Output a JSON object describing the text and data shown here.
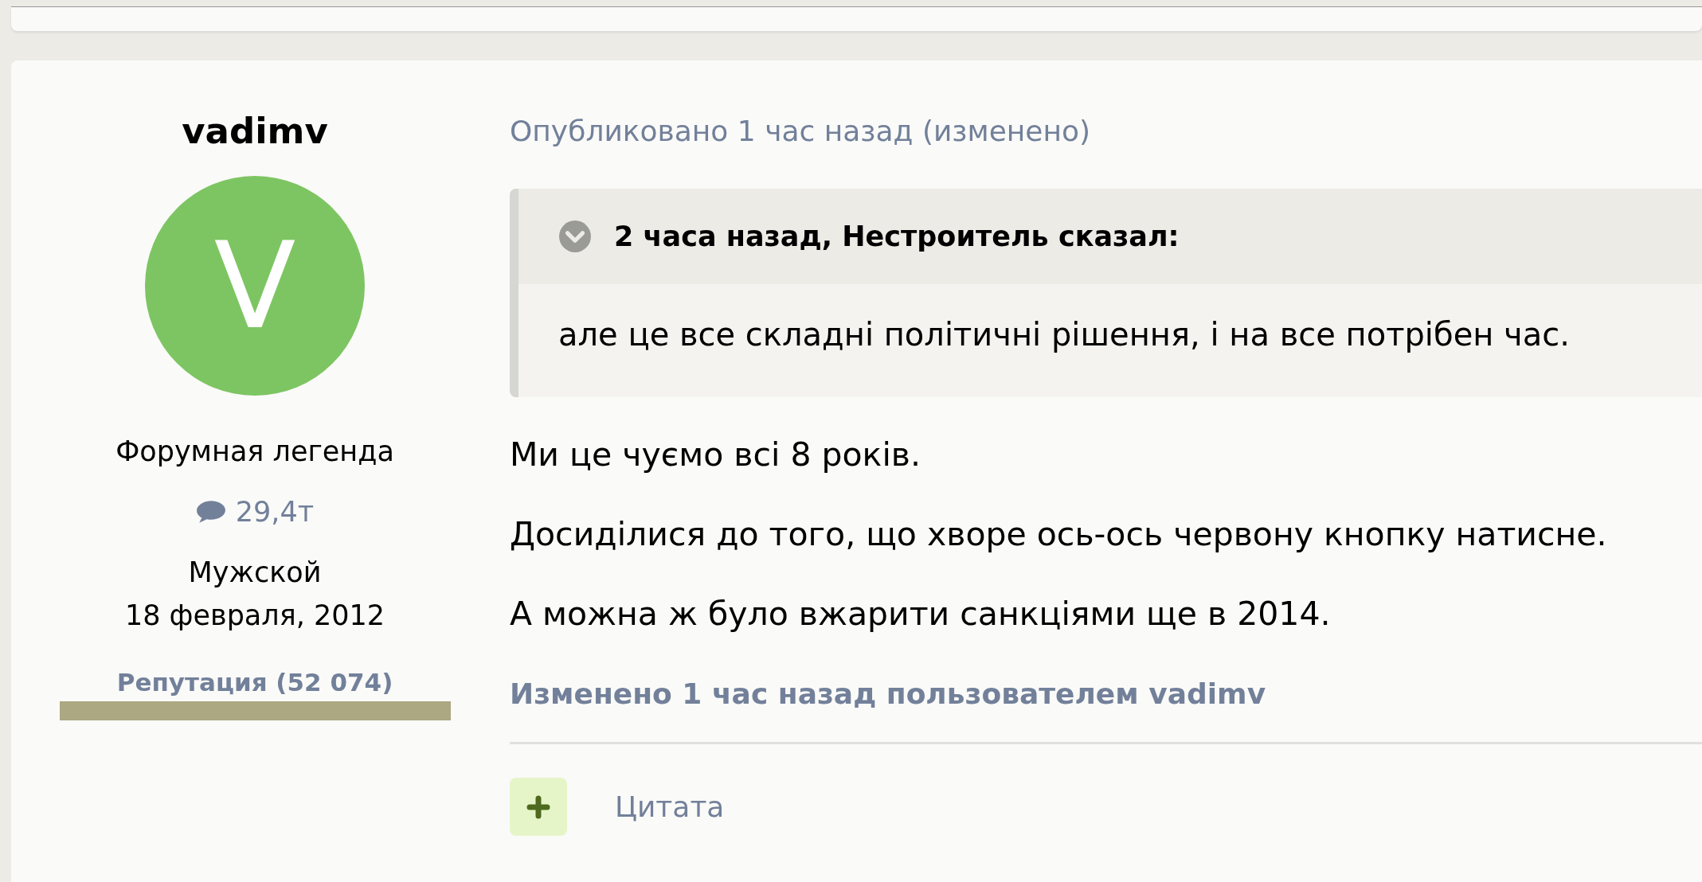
{
  "author": {
    "name": "vadimv",
    "avatar_letter": "V",
    "rank": "Форумная легенда",
    "posts": "29,4т",
    "gender": "Мужской",
    "joined": "18 февраля, 2012",
    "reputation": "Репутация (52 074)"
  },
  "post": {
    "meta": "Опубликовано 1 час назад (изменено)",
    "quote": {
      "expanded": false,
      "header": "2 часа назад, Нестроитель сказал:",
      "text": "але це все складні політичні рішення, і на все потрібен час."
    },
    "paragraphs": [
      "Ми це чуємо всі 8 років.",
      "Досиділися до того, що хворе ось-ось червону кнопку натисне.",
      "А можна ж було вжарити санкціями ще в 2014."
    ],
    "edited_note": "Изменено 1 час назад пользователем vadimv",
    "actions": [
      {
        "kind": "quote",
        "label": "Цитата"
      }
    ]
  }
}
